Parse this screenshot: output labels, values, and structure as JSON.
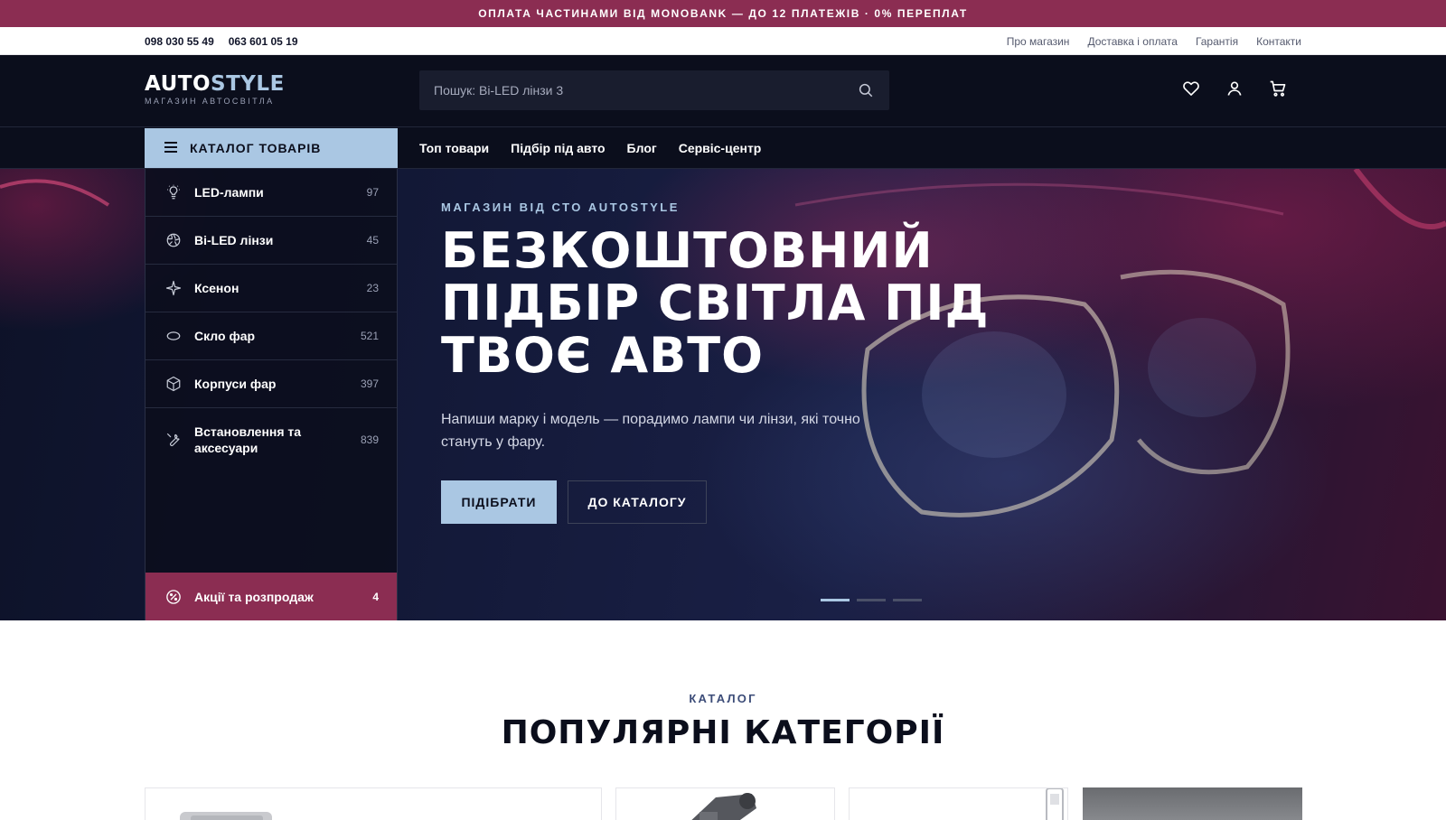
{
  "promo_bar": {
    "text": "ОПЛАТА ЧАСТИНАМИ ВІД MONOBANK — ДО 12 ПЛАТЕЖІВ · 0% ПЕРЕПЛАТ"
  },
  "topbar": {
    "phones": [
      "098 030 55 49",
      "063 601 05 19"
    ],
    "links": [
      "Про магазин",
      "Доставка і оплата",
      "Гарантія",
      "Контакти"
    ]
  },
  "header": {
    "logo_part1": "AUTO",
    "logo_part2": "STYLE",
    "logo_sub": "МАГАЗИН АВТОСВІТЛА",
    "search_placeholder": "Пошук: Bi-LED лінзи 3",
    "icons": [
      "heart-icon",
      "user-icon",
      "cart-icon"
    ]
  },
  "nav": {
    "catalog_label": "КАТАЛОГ ТОВАРІВ",
    "links": [
      "Топ товари",
      "Підбір під авто",
      "Блог",
      "Сервіс-центр"
    ]
  },
  "sidebar": {
    "items": [
      {
        "label": "LED-лампи",
        "count": "97",
        "icon": "bulb-icon"
      },
      {
        "label": "Bi-LED лінзи",
        "count": "45",
        "icon": "aperture-icon"
      },
      {
        "label": "Ксенон",
        "count": "23",
        "icon": "sparkle-icon"
      },
      {
        "label": "Скло фар",
        "count": "521",
        "icon": "oval-icon"
      },
      {
        "label": "Корпуси фар",
        "count": "397",
        "icon": "box-icon"
      },
      {
        "label": "Встановлення та аксесуари",
        "count": "839",
        "icon": "wrench-icon"
      }
    ],
    "promo": {
      "label": "Акції та розпродаж",
      "count": "4",
      "icon": "percent-icon"
    }
  },
  "hero": {
    "kicker": "МАГАЗИН ВІД СТО AUTOSTYLE",
    "title": "БЕЗКОШТОВНИЙ ПІДБІР СВІТЛА ПІД ТВОЄ АВТО",
    "description": "Напиши марку і модель — порадимо лампи чи лінзи, які точно стануть у фару.",
    "btn_primary": "ПІДІБРАТИ",
    "btn_secondary": "ДО КАТАЛОГУ",
    "slides": 3,
    "active_slide": 1
  },
  "popular": {
    "kicker": "КАТАЛОГ",
    "title": "ПОПУЛЯРНІ КАТЕГОРІЇ"
  },
  "colors": {
    "accent": "#aac7e3",
    "brand": "#8b2d52",
    "dark": "#0b0e1c"
  }
}
